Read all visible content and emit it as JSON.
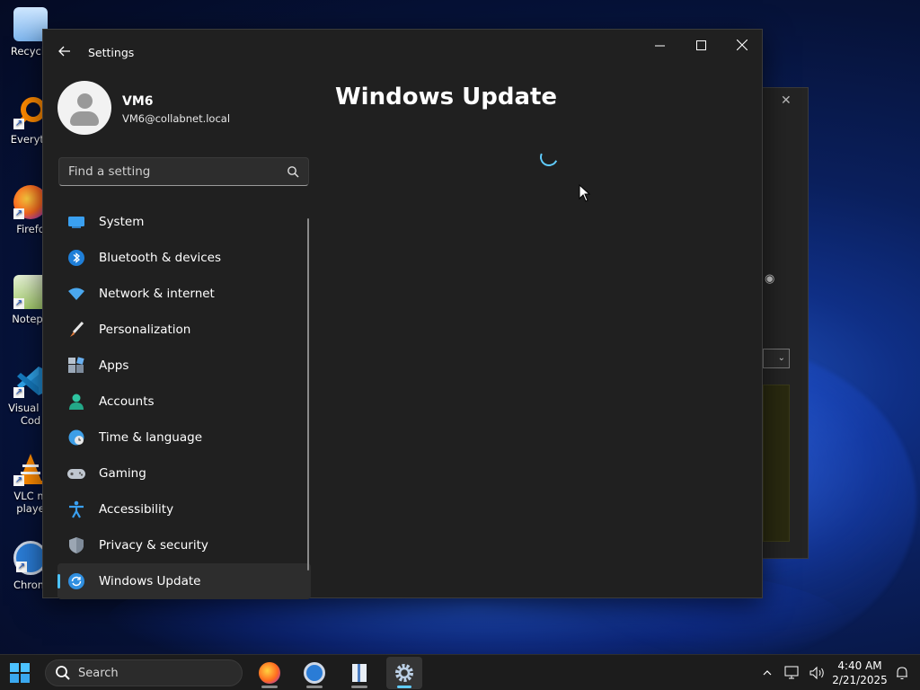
{
  "desktop": {
    "icons": [
      {
        "label": "Recycle",
        "icon": "recycle-bin-icon"
      },
      {
        "label": "Everyth",
        "icon": "everything-search-icon"
      },
      {
        "label": "Firefo",
        "icon": "firefox-icon"
      },
      {
        "label": "Notepa",
        "icon": "notepad-plus-plus-icon"
      },
      {
        "label": "Visual St Cod",
        "icon": "vscode-icon"
      },
      {
        "label": "VLC m playe",
        "icon": "vlc-icon"
      },
      {
        "label": "Chrom",
        "icon": "chrome-icon"
      }
    ]
  },
  "window": {
    "title": "Settings",
    "controls": [
      "minimize",
      "maximize",
      "close"
    ]
  },
  "profile": {
    "name": "VM6",
    "email": "VM6@collabnet.local"
  },
  "search": {
    "placeholder": "Find a setting"
  },
  "nav": {
    "items": [
      {
        "label": "System",
        "icon": "system-icon"
      },
      {
        "label": "Bluetooth & devices",
        "icon": "bluetooth-icon"
      },
      {
        "label": "Network & internet",
        "icon": "wifi-icon"
      },
      {
        "label": "Personalization",
        "icon": "brush-icon"
      },
      {
        "label": "Apps",
        "icon": "apps-icon"
      },
      {
        "label": "Accounts",
        "icon": "accounts-icon"
      },
      {
        "label": "Time & language",
        "icon": "globe-clock-icon"
      },
      {
        "label": "Gaming",
        "icon": "gamepad-icon"
      },
      {
        "label": "Accessibility",
        "icon": "accessibility-icon"
      },
      {
        "label": "Privacy & security",
        "icon": "shield-icon"
      },
      {
        "label": "Windows Update",
        "icon": "update-icon",
        "selected": true
      }
    ]
  },
  "main": {
    "title": "Windows Update",
    "state": "loading"
  },
  "taskbar": {
    "search_label": "Search",
    "apps": [
      "firefox-icon",
      "chrome-icon",
      "notepad-plus-plus-icon",
      "settings-icon"
    ],
    "active_app": "settings-icon",
    "time": "4:40 AM",
    "date": "2/21/2025"
  },
  "colors": {
    "accent": "#60cdff",
    "window_bg": "#202020",
    "taskbar_bg": "#1c1c1c"
  }
}
